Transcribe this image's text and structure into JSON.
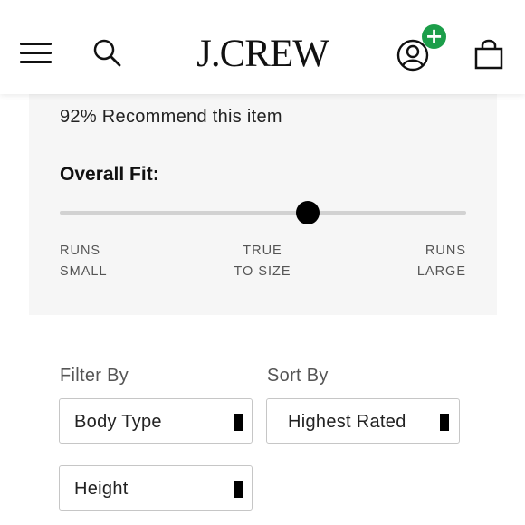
{
  "header": {
    "logo": "J.CREW",
    "account_badge": "+",
    "icons": [
      "menu-icon",
      "search-icon",
      "account-icon",
      "plus-badge",
      "bag-icon"
    ],
    "badge_color": "#1c9e4a"
  },
  "reviews": {
    "recommend_text": "92% Recommend this item",
    "fit_label": "Overall Fit:",
    "fit_value": 0.61,
    "scale_left_line1": "RUNS",
    "scale_left_line2": "SMALL",
    "scale_center_line1": "TRUE",
    "scale_center_line2": "TO SIZE",
    "scale_right_line1": "RUNS",
    "scale_right_line2": "LARGE"
  },
  "filters": {
    "filter_heading": "Filter By",
    "sort_heading": "Sort By",
    "body_type": "Body Type",
    "height": "Height",
    "sort_value": "Highest Rated"
  }
}
